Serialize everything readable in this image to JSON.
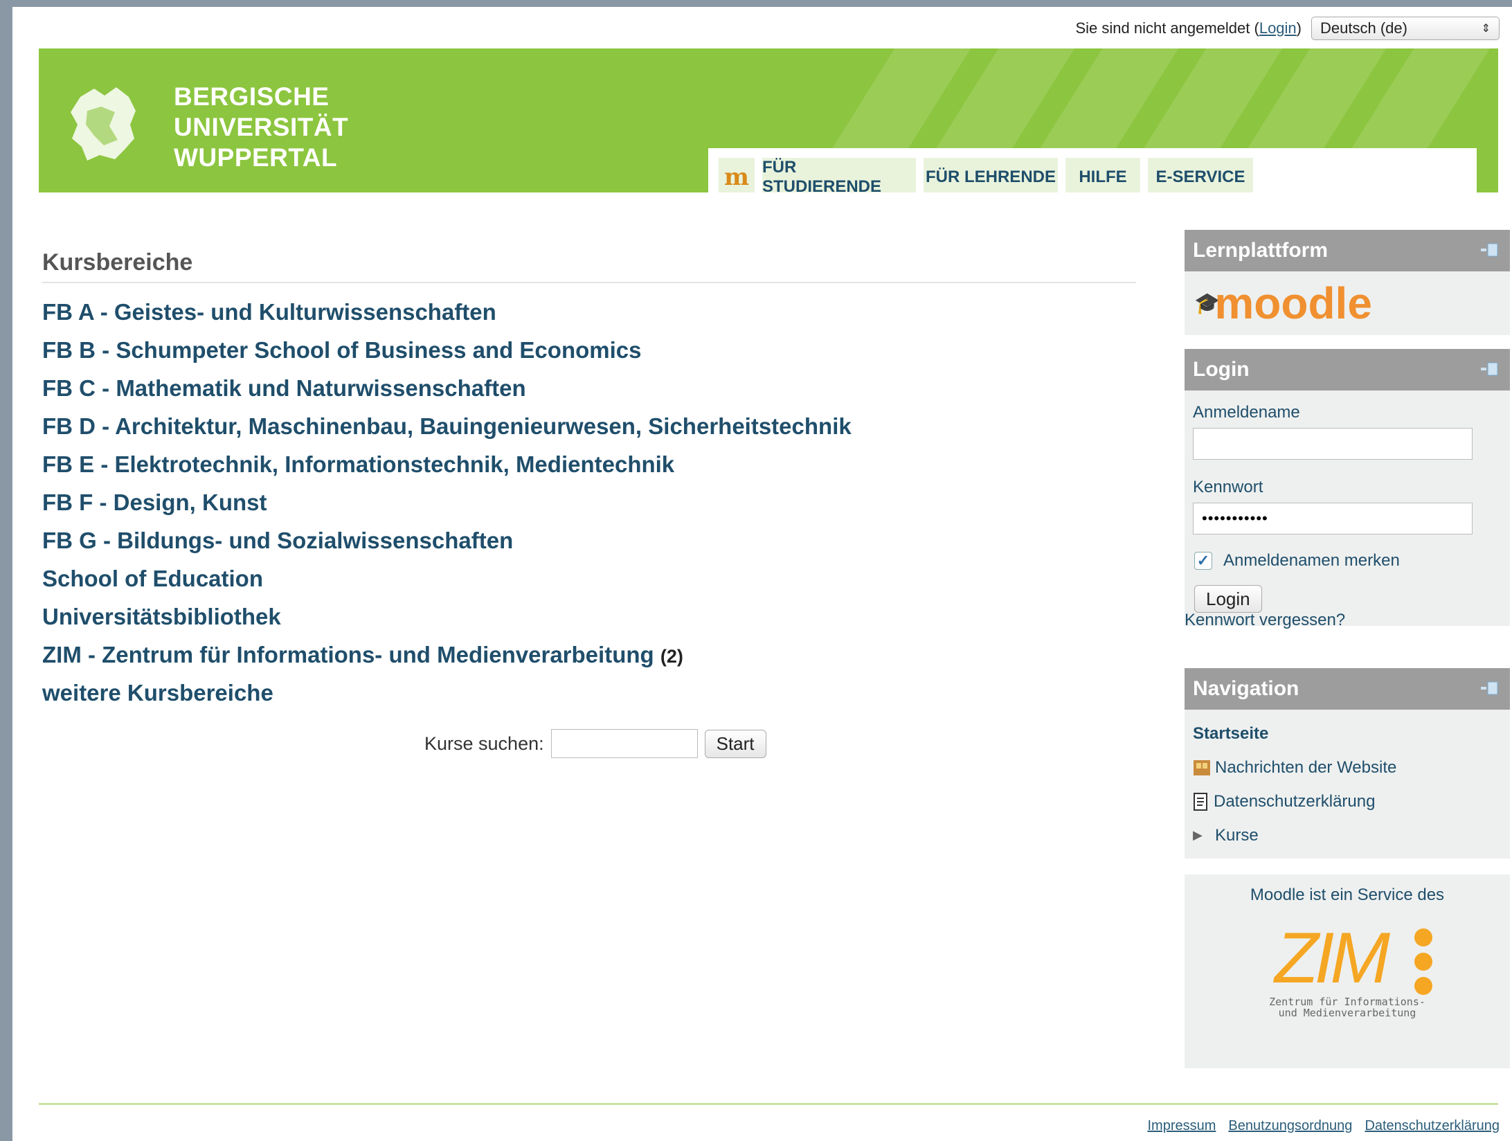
{
  "topbar": {
    "status_prefix": "Sie sind nicht angemeldet (",
    "login_link": "Login",
    "status_suffix": ")",
    "language": "Deutsch (de)"
  },
  "header": {
    "uni_line1": "BERGISCHE",
    "uni_line2": "UNIVERSITÄT",
    "uni_line3": "WUPPERTAL",
    "tabs": [
      "FÜR STUDIERENDE",
      "FÜR LEHRENDE",
      "HILFE",
      "E-SERVICE"
    ]
  },
  "main": {
    "heading": "Kursbereiche",
    "categories": [
      "FB A - Geistes- und Kulturwissenschaften",
      "FB B - Schumpeter School of Business and Economics",
      "FB C - Mathematik und Naturwissenschaften",
      "FB D - Architektur, Maschinenbau, Bauingenieurwesen, Sicherheitstechnik",
      "FB E - Elektrotechnik, Informationstechnik, Medientechnik",
      "FB F - Design, Kunst",
      "FB G - Bildungs- und Sozialwissenschaften",
      "School of Education",
      "Universitätsbibliothek",
      "ZIM - Zentrum für Informations- und Medienverarbeitung",
      "weitere Kursbereiche"
    ],
    "zim_count": "(2)",
    "search_label": "Kurse suchen:",
    "search_button": "Start"
  },
  "sidebar": {
    "lernplattform_title": "Lernplattform",
    "moodle_logo_text": "moodle",
    "login_title": "Login",
    "username_label": "Anmeldename",
    "password_label": "Kennwort",
    "password_value": "•••••••••••",
    "remember_label": "Anmeldenamen merken",
    "login_button": "Login",
    "forgot_link": "Kennwort vergessen?",
    "navigation_title": "Navigation",
    "nav_home": "Startseite",
    "nav_news": "Nachrichten der Website",
    "nav_privacy": "Datenschutzerklärung",
    "nav_courses": "Kurse",
    "service_text": "Moodle ist ein Service des",
    "zim_logo": "ZIM",
    "zim_sub1": "Zentrum für Informations-",
    "zim_sub2": "und Medienverarbeitung"
  },
  "footer": {
    "links": [
      "Impressum",
      "Benutzungsordnung",
      "Datenschutzerklärung"
    ]
  },
  "colors": {
    "brand_green": "#8cc53f",
    "link_blue": "#1f4e6b",
    "moodle_orange": "#f09030",
    "zim_orange": "#f5a623"
  }
}
